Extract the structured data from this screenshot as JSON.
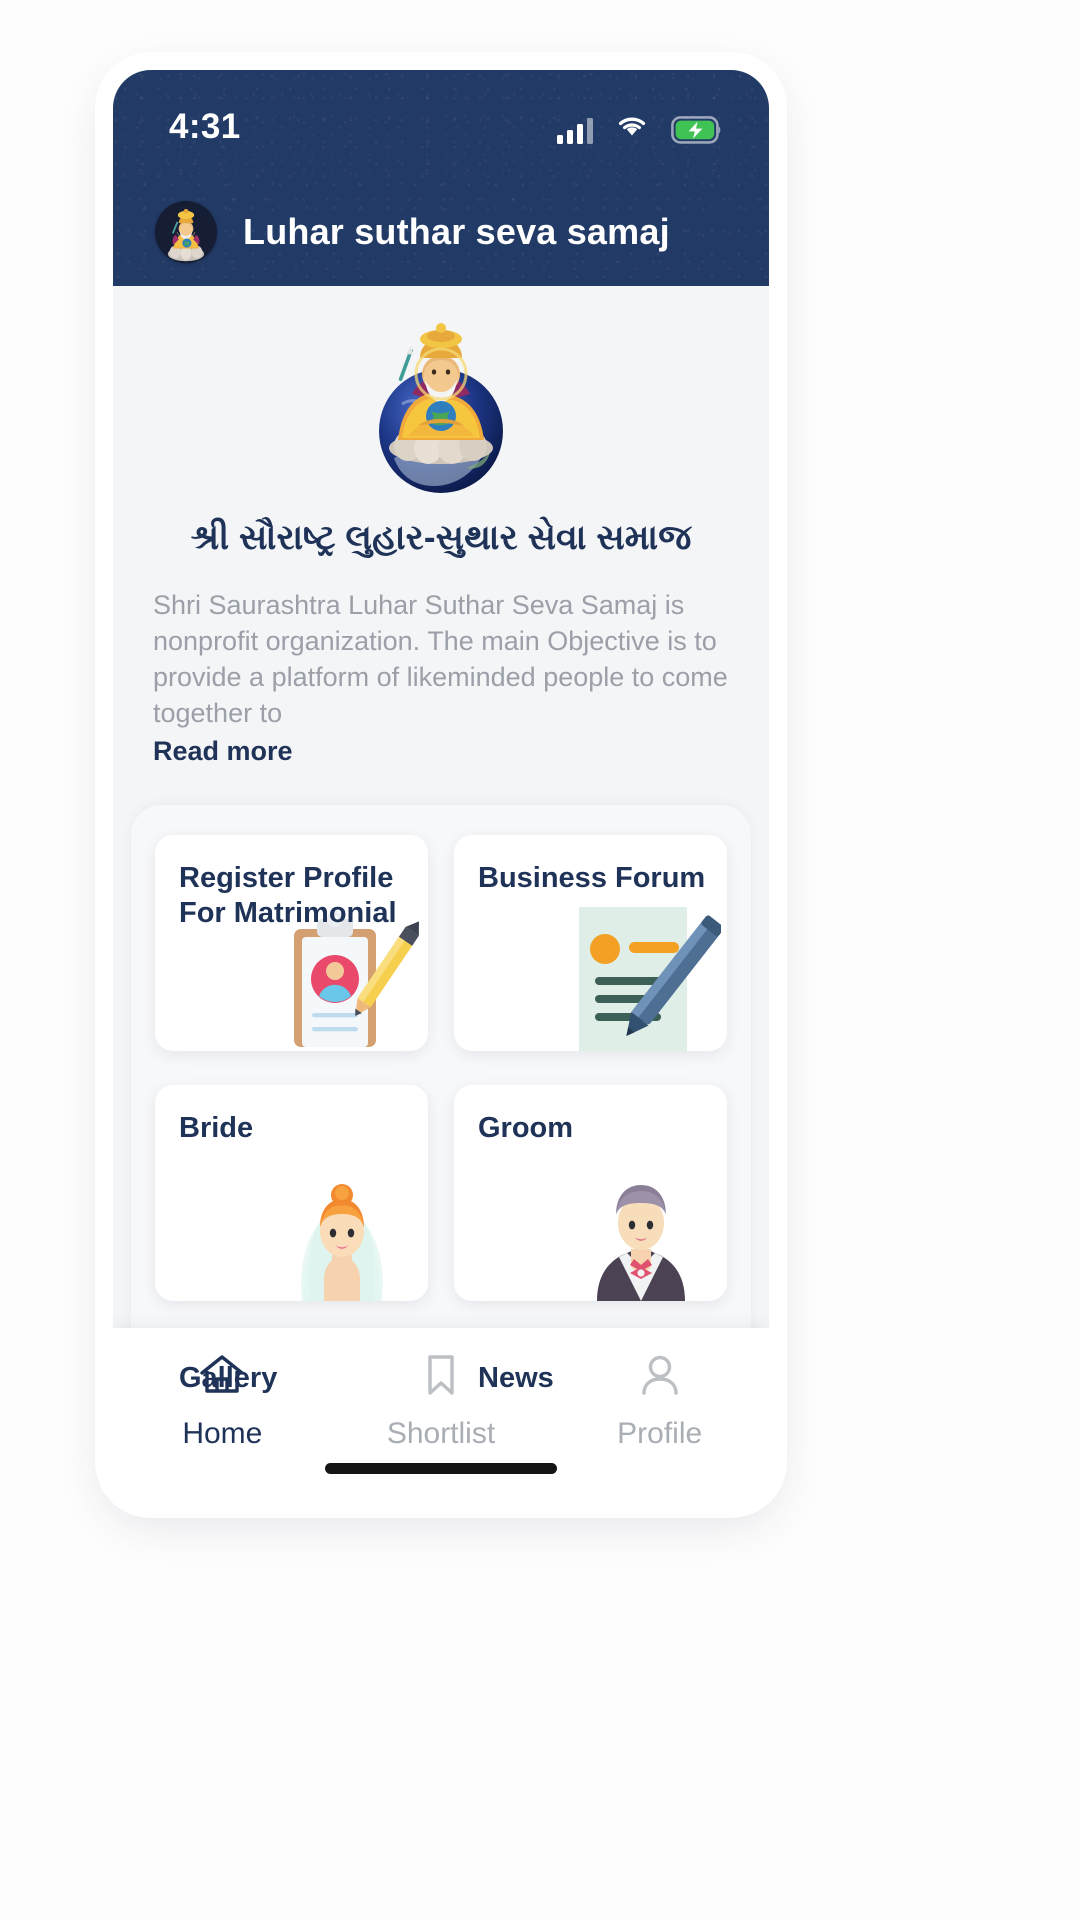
{
  "status_bar": {
    "time": "4:31",
    "signal_icon": "signal-bars-icon",
    "wifi_icon": "wifi-icon",
    "battery_icon": "battery-charging-icon",
    "battery_color": "#3fc355"
  },
  "app_header": {
    "title": "Luhar suthar seva samaj",
    "avatar_icon": "vishwakarma-avatar-icon",
    "background_color": "#223a66"
  },
  "hero": {
    "logo_icon": "vishwakarma-globe-logo",
    "title": "શ્રી સૌરાષ્ટ્ર લુહાર-સુથાર સેવા સમાજ",
    "description": "Shri Saurashtra Luhar Suthar Seva Samaj is nonprofit organization. The main Objective is to provide a platform of likeminded people to come together to",
    "read_more_label": "Read more"
  },
  "tiles": [
    {
      "label": "Register Profile For Matrimonial",
      "art": "clipboard-profile-pencil-icon"
    },
    {
      "label": "Business Forum",
      "art": "document-pen-icon"
    },
    {
      "label": "Bride",
      "art": "bride-avatar-icon"
    },
    {
      "label": "Groom",
      "art": "groom-avatar-icon"
    },
    {
      "label": "Gallery",
      "art": "gallery-icon"
    },
    {
      "label": "News",
      "art": "news-icon"
    }
  ],
  "bottom_nav": {
    "items": [
      {
        "label": "Home",
        "icon": "home-icon",
        "active": true
      },
      {
        "label": "Shortlist",
        "icon": "bookmark-icon",
        "active": false
      },
      {
        "label": "Profile",
        "icon": "person-icon",
        "active": false
      }
    ],
    "active_color": "#1f3257",
    "inactive_color": "#a9adb4"
  }
}
